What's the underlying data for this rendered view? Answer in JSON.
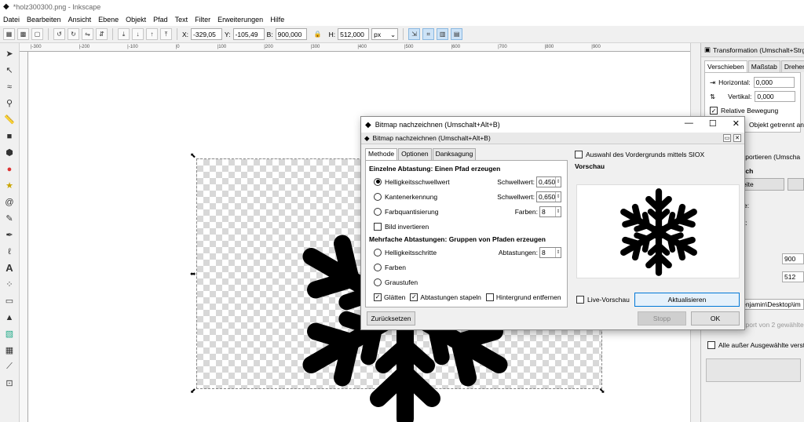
{
  "window": {
    "title": "*holz300300.png - Inkscape"
  },
  "menu": [
    "Datei",
    "Bearbeiten",
    "Ansicht",
    "Ebene",
    "Objekt",
    "Pfad",
    "Text",
    "Filter",
    "Erweiterungen",
    "Hilfe"
  ],
  "toolbar": {
    "x_label": "X:",
    "x_value": "-329,05",
    "y_label": "Y:",
    "y_value": "-105,49",
    "w_label": "B:",
    "w_value": "900,000",
    "h_label": "H:",
    "h_value": "512,000",
    "unit": "px"
  },
  "ruler": [
    "|-300",
    "|-200",
    "|-100",
    "|0",
    "|100",
    "|200",
    "|300",
    "|400",
    "|500",
    "|600",
    "|700",
    "|800",
    "|900",
    "|1000"
  ],
  "dock": {
    "title": "Transformation (Umschalt+Strg",
    "tabs": [
      "Verschieben",
      "Maßstab",
      "Drehen"
    ],
    "horizontal_label": "Horizontal:",
    "horizontal_value": "0,000",
    "vertikal_label": "Vertikal:",
    "vertikal_value": "0,000",
    "relative_label": "Relative Bewegung",
    "objekt_label": "Objekt getrennt an",
    "export_label": "xportieren (Umscha",
    "ich_label": "ich",
    "seite_label": "eite",
    "partial_e": "e:",
    "partial_t": "t:",
    "w_value": "900",
    "h_value": "512",
    "path_value": "C:\\Users\\Benjamin\\Desktop\\im",
    "batch_label": "Batch-Export von 2 gewählte",
    "alle_label": "Alle außer Ausgewählte verst"
  },
  "dialog": {
    "title": "Bitmap nachzeichnen (Umschalt+Alt+B)",
    "subtitle": "Bitmap nachzeichnen (Umschalt+Alt+B)",
    "tabs": [
      "Methode",
      "Optionen",
      "Danksagung"
    ],
    "group1": "Einzelne Abtastung: Einen Pfad erzeugen",
    "r1": "Helligkeitsschwellwert",
    "r1_field": "Schwellwert:",
    "r1_value": "0,450",
    "r2": "Kantenerkennung",
    "r2_field": "Schwellwert:",
    "r2_value": "0,650",
    "r3": "Farbquantisierung",
    "r3_field": "Farben:",
    "r3_value": "8",
    "invert": "Bild invertieren",
    "group2": "Mehrfache Abtastungen: Gruppen von Pfaden erzeugen",
    "m1": "Helligkeitsschritte",
    "m1_field": "Abtastungen:",
    "m1_value": "8",
    "m2": "Farben",
    "m3": "Graustufen",
    "smooth": "Glätten",
    "stack": "Abtastungen stapeln",
    "remove_bg": "Hintergrund entfernen",
    "siox": "Auswahl des Vordergrunds mittels SIOX",
    "preview_label": "Vorschau",
    "live": "Live-Vorschau",
    "update": "Aktualisieren",
    "reset": "Zurücksetzen",
    "stop": "Stopp",
    "ok": "OK"
  }
}
